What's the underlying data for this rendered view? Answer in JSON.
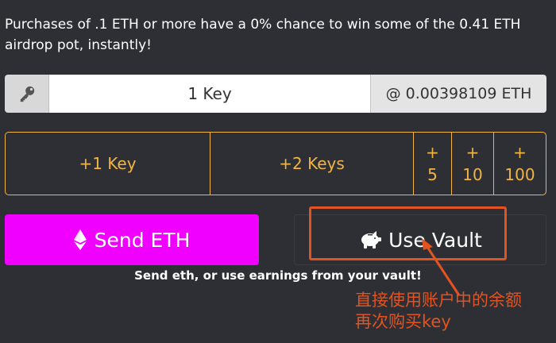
{
  "notice": "Purchases of .1 ETH or more have a 0% chance to win some of the 0.41 ETH airdrop pot, instantly!",
  "purchase": {
    "key_icon": "key-icon",
    "quantity": "1 Key",
    "price": "@ 0.00398109 ETH"
  },
  "quick_add": {
    "one_key": "+1 Key",
    "two_keys": "+2 Keys",
    "plus": "+",
    "five": "5",
    "ten": "10",
    "hundred": "100"
  },
  "actions": {
    "send_label": "Send ETH",
    "send_icon": "ethereum-icon",
    "vault_label": "Use Vault",
    "vault_icon": "piggy-bank-icon",
    "helper": "Send eth, or use earnings from your vault!"
  },
  "annotation": {
    "line1": "直接使用账户中的余额",
    "line2": "再次购买key"
  },
  "colors": {
    "background": "#2e2f35",
    "accent_gold": "#f0b445",
    "send_button": "#f000ff",
    "annotation_red": "#e2531f"
  }
}
